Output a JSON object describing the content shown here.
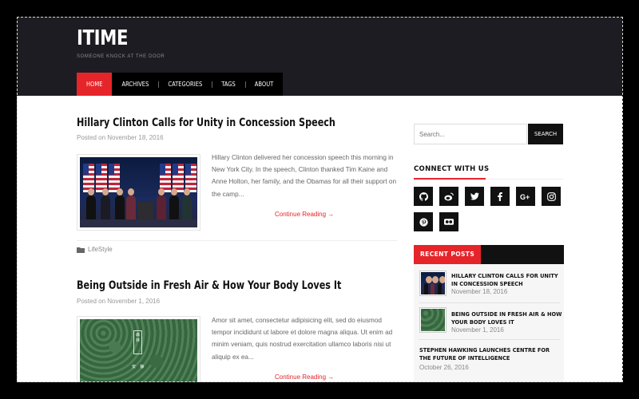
{
  "site": {
    "title": "ITIME",
    "tagline": "SOMEONE KNOCK AT THE DOOR"
  },
  "nav": [
    {
      "label": "HOME",
      "active": true
    },
    {
      "label": "ARCHIVES"
    },
    {
      "label": "CATEGORIES"
    },
    {
      "label": "TAGS"
    },
    {
      "label": "ABOUT"
    }
  ],
  "posts": [
    {
      "title": "Hillary Clinton Calls for Unity in Concession Speech",
      "date": "Posted on November 18, 2016",
      "excerpt": "Hillary Clinton delivered her concession speech this morning in New York City. In the speech, Clinton thanked Tim Kaine and Anne Holton, her family, and the Obamas for all their support on the camp...",
      "continue": "Continue Reading →",
      "category": "LifeStyle"
    },
    {
      "title": "Being Outside in Fresh Air & How Your Body Loves It",
      "date": "Posted on November 1, 2016",
      "excerpt": "Amor sit amet, consectetur adipisicing elit, sed do eiusmod tempor incididunt ut labore et dolore magna aliqua. Ut enim ad minim veniam, quis nostrud exercitation ullamco laboris nisi ut aliquip ex ea...",
      "continue": "Continue Reading →"
    }
  ],
  "sidebar": {
    "search": {
      "placeholder": "Search...",
      "button": "SEARCH"
    },
    "connect_title": "CONNECT WITH US",
    "social_icons": [
      "github-icon",
      "weibo-icon",
      "twitter-icon",
      "facebook-icon",
      "google-plus-icon",
      "instagram-icon",
      "pinterest-icon",
      "flickr-icon"
    ],
    "recent_title": "RECENT POSTS",
    "recent": [
      {
        "title": "HILLARY CLINTON CALLS FOR UNITY IN CONCESSION SPEECH",
        "date": "November 18, 2016"
      },
      {
        "title": "BEING OUTSIDE IN FRESH AIR & HOW YOUR BODY LOVES IT",
        "date": "November 1, 2016"
      },
      {
        "title": "STEPHEN HAWKING LAUNCHES CENTRE FOR THE FUTURE OF INTELLIGENCE",
        "date": "October 26, 2016"
      }
    ]
  },
  "colors": {
    "accent": "#e5252a",
    "header_bg": "#1c1c22",
    "nav_bg": "#000000"
  }
}
